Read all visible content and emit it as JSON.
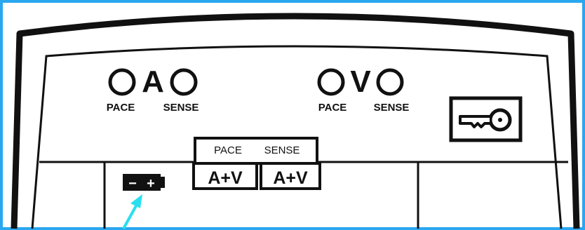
{
  "colors": {
    "frame_border": "#2aa7ee",
    "line": "#111111",
    "background": "#ffffff",
    "pointer_arrow": "#28e0ee"
  },
  "atrial": {
    "letter": "A",
    "left_label": "PACE",
    "right_label": "SENSE"
  },
  "ventricular": {
    "letter": "V",
    "left_label": "PACE",
    "right_label": "SENSE"
  },
  "mode_box": {
    "pace_header": "PACE",
    "sense_header": "SENSE",
    "pace_value": "A+V",
    "sense_value": "A+V"
  },
  "battery": {
    "minus": "−",
    "plus": "+"
  },
  "icons": {
    "lock": "key-icon",
    "battery": "battery-icon",
    "pointer": "arrow-icon"
  }
}
